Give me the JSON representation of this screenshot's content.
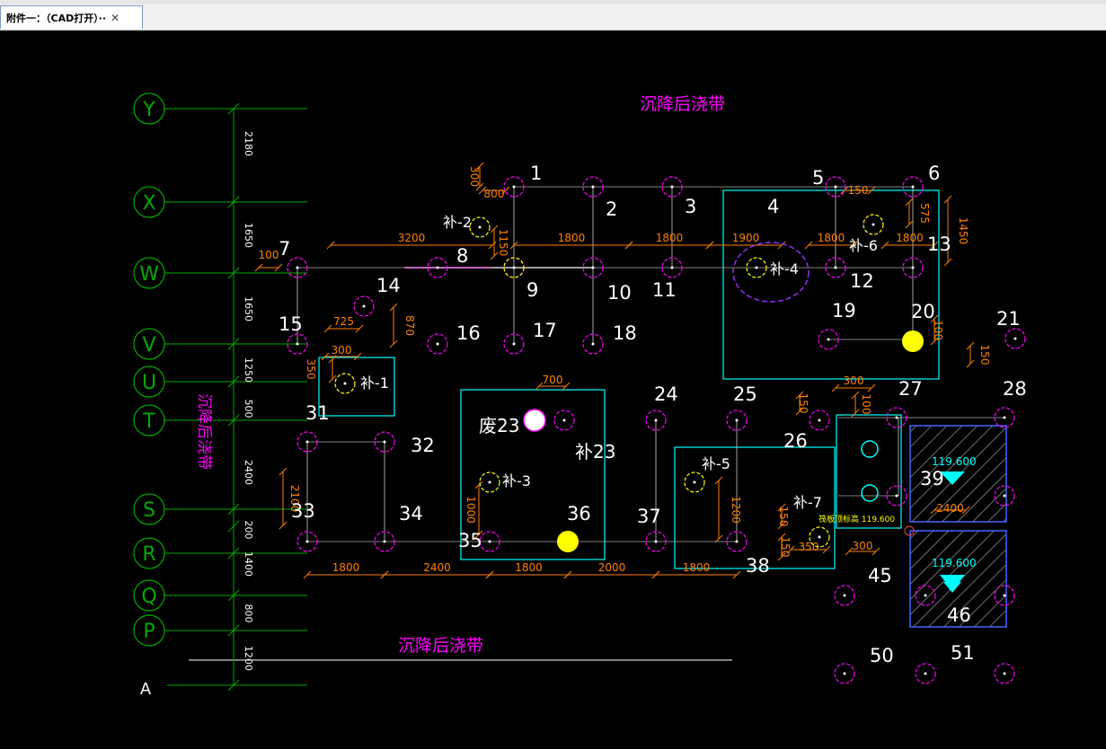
{
  "tab": {
    "title": "附件一：（CAD打开）··",
    "close_glyph": "✕"
  },
  "colors": {
    "background": "#000000",
    "axis": "#00aa00",
    "dim": "#ff8000",
    "pile": "#ff00ff",
    "region": "#00ffff",
    "text_white": "#ffffff",
    "note": "#ff00ff",
    "yellow": "#ffff00"
  },
  "axis_labels": [
    "Y",
    "X",
    "W",
    "V",
    "U",
    "T",
    "S",
    "R",
    "Q",
    "P",
    "A"
  ],
  "axis_spacings": [
    "2180",
    "1650",
    "1650",
    "1250",
    "500",
    "2400",
    "200",
    "1400",
    "800",
    "1200"
  ],
  "notes": {
    "top": "沉降后浇带",
    "bottom": "沉降后浇带",
    "left": "沉降后浇带"
  },
  "pile_numbers": [
    "1",
    "2",
    "3",
    "4",
    "5",
    "6",
    "7",
    "8",
    "9",
    "10",
    "11",
    "12",
    "13",
    "14",
    "15",
    "16",
    "17",
    "18",
    "19",
    "20",
    "21",
    "24",
    "25",
    "26",
    "27",
    "28",
    "31",
    "32",
    "33",
    "34",
    "35",
    "36",
    "37",
    "38",
    "39",
    "45",
    "46",
    "50",
    "51"
  ],
  "supplement_labels": [
    "补-1",
    "补-2",
    "补-3",
    "补-4",
    "补-5",
    "补-6",
    "补-7",
    "补23",
    "废23"
  ],
  "dims_horizontal": [
    "3200",
    "1800",
    "1800",
    "1800",
    "1900",
    "1800",
    "1800",
    "800",
    "150",
    "725",
    "300",
    "700",
    "300",
    "100",
    "1800",
    "2400",
    "1800",
    "2000",
    "1800",
    "300",
    "350",
    "2400"
  ],
  "dims_vertical": [
    "300",
    "575",
    "1450",
    "870",
    "350",
    "1000",
    "1200",
    "150",
    "150",
    "150",
    "2100",
    "100",
    "150",
    "100",
    "1150"
  ],
  "elevations": [
    "119.600",
    "119.600"
  ],
  "small_label": "筏板顶标高 119.600"
}
